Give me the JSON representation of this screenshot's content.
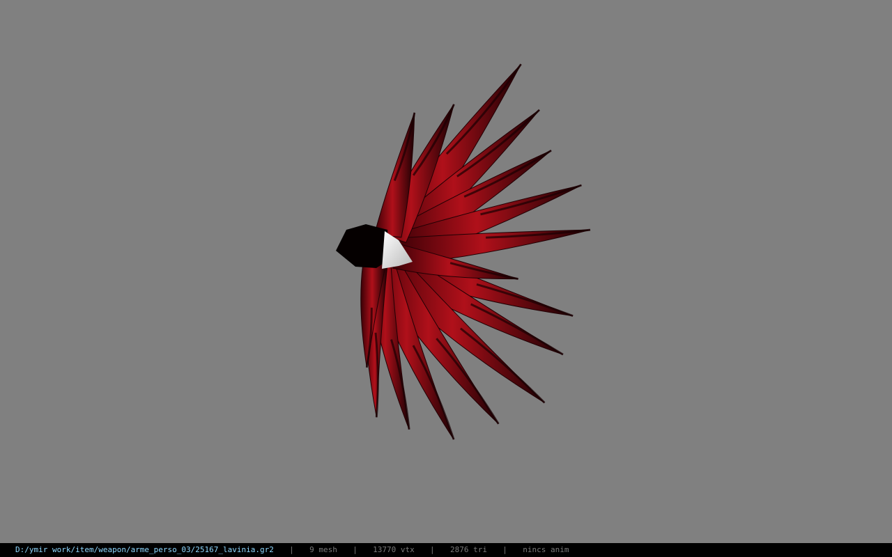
{
  "viewer": {
    "background_color": "#808080"
  },
  "status_bar": {
    "file_path": "D:/ymir work/item/weapon/arme_perso_03/25167_lavinia.gr2",
    "separator": "|",
    "mesh_count": "9 mesh",
    "vertex_count": "13770 vtx",
    "triangle_count": "2876 tri",
    "animation": "nincs anim",
    "path_color": "#8fd8ff",
    "stat_color": "#7a7a7a"
  },
  "model": {
    "main_color": "#b0101a",
    "dark_color": "#1a0003",
    "hilt_color": "#e6e6e6"
  }
}
